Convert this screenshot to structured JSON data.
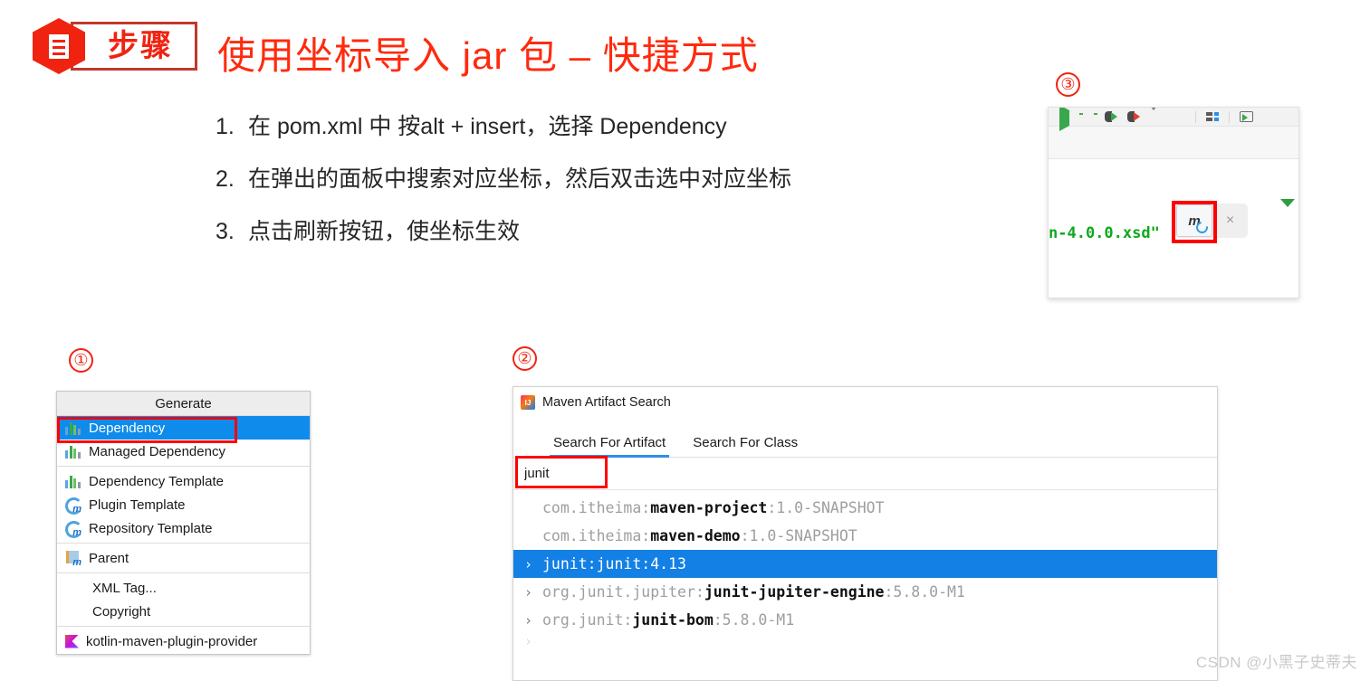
{
  "header": {
    "badge_icon": "document-icon",
    "badge_label": "步骤",
    "title": "使用坐标导入 jar 包 – 快捷方式"
  },
  "steps": [
    {
      "num": "1.",
      "text": "在 pom.xml 中 按alt + insert，选择 Dependency"
    },
    {
      "num": "2.",
      "text": "在弹出的面板中搜索对应坐标，然后双击选中对应坐标"
    },
    {
      "num": "3.",
      "text": "点击刷新按钮，使坐标生效"
    }
  ],
  "markers": {
    "one": "①",
    "two": "②",
    "three": "③"
  },
  "generate_popup": {
    "header": "Generate",
    "items": [
      {
        "label": "Dependency",
        "icon": "maven-bars-icon",
        "selected": true
      },
      {
        "label": "Managed Dependency",
        "icon": "maven-bars-icon",
        "selected": false
      },
      {
        "label": "Dependency Template",
        "icon": "maven-bars-icon",
        "selected": false
      },
      {
        "label": "Plugin Template",
        "icon": "maven-plugin-icon",
        "selected": false
      },
      {
        "label": "Repository Template",
        "icon": "maven-plugin-icon",
        "selected": false
      },
      {
        "label": "Parent",
        "icon": "maven-parent-icon",
        "selected": false
      },
      {
        "label": "XML Tag...",
        "icon": "none",
        "selected": false
      },
      {
        "label": "Copyright",
        "icon": "none",
        "selected": false
      },
      {
        "label": "kotlin-maven-plugin-provider",
        "icon": "kotlin-icon",
        "selected": false
      }
    ]
  },
  "maven_search": {
    "window_icon": "intellij-idea-icon",
    "title": "Maven Artifact Search",
    "tabs": [
      {
        "label": "Search For Artifact",
        "active": true
      },
      {
        "label": "Search For Class",
        "active": false
      }
    ],
    "search_value": "junit",
    "search_placeholder": "",
    "results": [
      {
        "arrow": "",
        "group": "com.itheima:",
        "artifact": "maven-project",
        "version": ":1.0-SNAPSHOT",
        "selected": false
      },
      {
        "arrow": "",
        "group": "com.itheima:",
        "artifact": "maven-demo",
        "version": ":1.0-SNAPSHOT",
        "selected": false
      },
      {
        "arrow": "›",
        "group": "junit:",
        "artifact": "junit",
        "version": ":4.13",
        "selected": true
      },
      {
        "arrow": "›",
        "group": "org.junit.jupiter:",
        "artifact": "junit-jupiter-engine",
        "version": ":5.8.0-M1",
        "selected": false
      },
      {
        "arrow": "›",
        "group": "org.junit:",
        "artifact": "junit-bom",
        "version": ":5.8.0-M1",
        "selected": false
      }
    ]
  },
  "ide_snippet": {
    "code_text": "n-4.0.0.xsd\"",
    "maven_reload_label": "m",
    "close_label": "×"
  },
  "watermark": "CSDN @小黑子史蒂夫",
  "colors": {
    "accent_red": "#FF2A0E",
    "highlight_red": "#FF0000",
    "selection_blue": "#0F8CEB",
    "list_selection_blue": "#1380E5",
    "tab_underline_blue": "#2F8FEA"
  }
}
